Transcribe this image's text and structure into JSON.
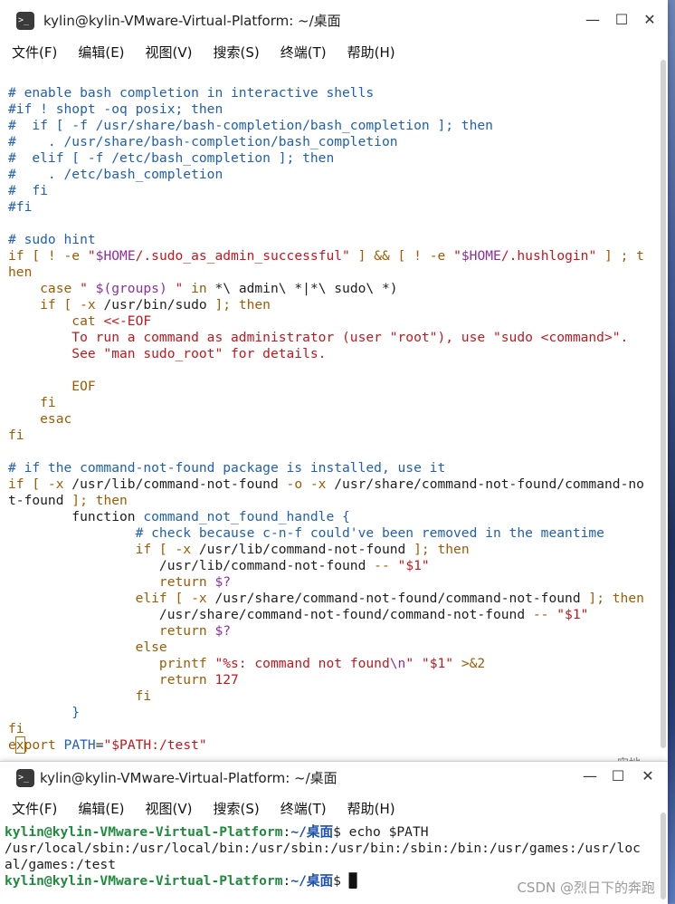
{
  "win1": {
    "title": "kylin@kylin-VMware-Virtual-Platform: ~/桌面",
    "menu": [
      "文件(F)",
      "编辑(E)",
      "视图(V)",
      "搜索(S)",
      "终端(T)",
      "帮助(H)"
    ],
    "icons": {
      "app": "terminal-icon",
      "minimize": "minimize-icon",
      "maximize": "maximize-icon",
      "close": "close-icon"
    }
  },
  "vim_lines": [
    [
      {
        "t": "# enable bash completion in interactive shells",
        "c": "c"
      }
    ],
    [
      {
        "t": "#if ! shopt -oq posix; then",
        "c": "c"
      }
    ],
    [
      {
        "t": "#  if [ -f /usr/share/bash-completion/bash_completion ]; then",
        "c": "c"
      }
    ],
    [
      {
        "t": "#    . /usr/share/bash-completion/bash_completion",
        "c": "c"
      }
    ],
    [
      {
        "t": "#  elif [ -f /etc/bash_completion ]; then",
        "c": "c"
      }
    ],
    [
      {
        "t": "#    . /etc/bash_completion",
        "c": "c"
      }
    ],
    [
      {
        "t": "#  fi",
        "c": "c"
      }
    ],
    [
      {
        "t": "#fi",
        "c": "c"
      }
    ],
    [
      {
        "t": "",
        "c": "d"
      }
    ],
    [
      {
        "t": "# sudo hint",
        "c": "c"
      }
    ],
    [
      {
        "t": "if [ ! -e ",
        "c": "k"
      },
      {
        "t": "\"",
        "c": "s"
      },
      {
        "t": "$HOME",
        "c": "v"
      },
      {
        "t": "/.sudo_as_admin_successful\"",
        "c": "s"
      },
      {
        "t": " ] && [ ! -e ",
        "c": "k"
      },
      {
        "t": "\"",
        "c": "s"
      },
      {
        "t": "$HOME",
        "c": "v"
      },
      {
        "t": "/.hushlogin\"",
        "c": "s"
      },
      {
        "t": " ] ; t",
        "c": "k"
      }
    ],
    [
      {
        "t": "hen",
        "c": "k"
      }
    ],
    [
      {
        "t": "    case ",
        "c": "k"
      },
      {
        "t": "\" ",
        "c": "s"
      },
      {
        "t": "$(groups)",
        "c": "v"
      },
      {
        "t": " \"",
        "c": "s"
      },
      {
        "t": " in ",
        "c": "k"
      },
      {
        "t": "*\\ admin\\ *|*\\ sudo\\ *)",
        "c": "d"
      }
    ],
    [
      {
        "t": "    if [ -x ",
        "c": "k"
      },
      {
        "t": "/usr/bin/sudo",
        "c": "d"
      },
      {
        "t": " ]; then",
        "c": "k"
      }
    ],
    [
      {
        "t": "        cat ",
        "c": "k"
      },
      {
        "t": "<<-EOF",
        "c": "s"
      }
    ],
    [
      {
        "t": "        To run a command as administrator (user \"root\"), use \"sudo <command>\".",
        "c": "s"
      }
    ],
    [
      {
        "t": "        See \"man sudo_root\" for details.",
        "c": "s"
      }
    ],
    [
      {
        "t": "",
        "c": "d"
      }
    ],
    [
      {
        "t": "        EOF",
        "c": "k"
      }
    ],
    [
      {
        "t": "    fi",
        "c": "k"
      }
    ],
    [
      {
        "t": "    esac",
        "c": "k"
      }
    ],
    [
      {
        "t": "fi",
        "c": "k"
      }
    ],
    [
      {
        "t": "",
        "c": "d"
      }
    ],
    [
      {
        "t": "# if the command-not-found package is installed, use it",
        "c": "c"
      }
    ],
    [
      {
        "t": "if [ -x ",
        "c": "k"
      },
      {
        "t": "/usr/lib/command-not-found",
        "c": "d"
      },
      {
        "t": " -o -x ",
        "c": "k"
      },
      {
        "t": "/usr/share/command-not-found/command-no",
        "c": "d"
      }
    ],
    [
      {
        "t": "t-found",
        "c": "d"
      },
      {
        "t": " ]; then",
        "c": "k"
      }
    ],
    [
      {
        "t": "        function ",
        "c": "d"
      },
      {
        "t": "command_not_found_handle {",
        "c": "sp"
      }
    ],
    [
      {
        "t": "                # check because c-n-f could've been removed in the meantime",
        "c": "c"
      }
    ],
    [
      {
        "t": "                if [ -x ",
        "c": "k"
      },
      {
        "t": "/usr/lib/command-not-found",
        "c": "d"
      },
      {
        "t": " ]; then",
        "c": "k"
      }
    ],
    [
      {
        "t": "                   /usr/lib/command-not-found ",
        "c": "d"
      },
      {
        "t": "-- ",
        "c": "k"
      },
      {
        "t": "\"$1\"",
        "c": "s"
      }
    ],
    [
      {
        "t": "                   return ",
        "c": "k"
      },
      {
        "t": "$?",
        "c": "v"
      }
    ],
    [
      {
        "t": "                elif [ -x ",
        "c": "k"
      },
      {
        "t": "/usr/share/command-not-found/command-not-found",
        "c": "d"
      },
      {
        "t": " ]; then",
        "c": "k"
      }
    ],
    [
      {
        "t": "                   /usr/share/command-not-found/command-not-found ",
        "c": "d"
      },
      {
        "t": "-- ",
        "c": "k"
      },
      {
        "t": "\"$1\"",
        "c": "s"
      }
    ],
    [
      {
        "t": "                   return ",
        "c": "k"
      },
      {
        "t": "$?",
        "c": "v"
      }
    ],
    [
      {
        "t": "                else",
        "c": "k"
      }
    ],
    [
      {
        "t": "                   printf ",
        "c": "k"
      },
      {
        "t": "\"%s: command not found",
        "c": "s"
      },
      {
        "t": "\\n",
        "c": "v"
      },
      {
        "t": "\"",
        "c": "s"
      },
      {
        "t": " ",
        "c": "d"
      },
      {
        "t": "\"$1\"",
        "c": "s"
      },
      {
        "t": " >&2",
        "c": "k"
      }
    ],
    [
      {
        "t": "                   return ",
        "c": "k"
      },
      {
        "t": "127",
        "c": "s"
      }
    ],
    [
      {
        "t": "                fi",
        "c": "k"
      }
    ],
    [
      {
        "t": "        }",
        "c": "sp"
      }
    ],
    [
      {
        "t": "fi",
        "c": "k"
      }
    ],
    [
      {
        "t": "e",
        "c": "k"
      },
      {
        "t": "x",
        "c": "k",
        "cur": true
      },
      {
        "t": "port ",
        "c": "k"
      },
      {
        "t": "PATH",
        "c": "sp"
      },
      {
        "t": "=",
        "c": "d"
      },
      {
        "t": "\"$PATH:/test\"",
        "c": "s"
      }
    ]
  ],
  "win2": {
    "title": "kylin@kylin-VMware-Virtual-Platform: ~/桌面",
    "menu": [
      "文件(F)",
      "编辑(E)",
      "视图(V)",
      "搜索(S)",
      "终端(T)",
      "帮助(H)"
    ],
    "icons": {
      "app": "terminal-icon",
      "minimize": "minimize-icon",
      "maximize": "maximize-icon",
      "close": "close-icon"
    }
  },
  "terminal": {
    "prompt_user": "kylin@kylin-VMware-Virtual-Platform",
    "prompt_sep": ":",
    "prompt_dir": "~/桌面",
    "prompt_sym": "$ ",
    "command1": "echo $PATH",
    "output_line1": "/usr/local/sbin:/usr/local/bin:/usr/sbin:/usr/bin:/sbin:/bin:/usr/games:/usr/loc",
    "output_line2": "al/games:/test",
    "command2": ""
  },
  "peek_text": "实地",
  "watermark": "CSDN @烈日下的奔跑"
}
